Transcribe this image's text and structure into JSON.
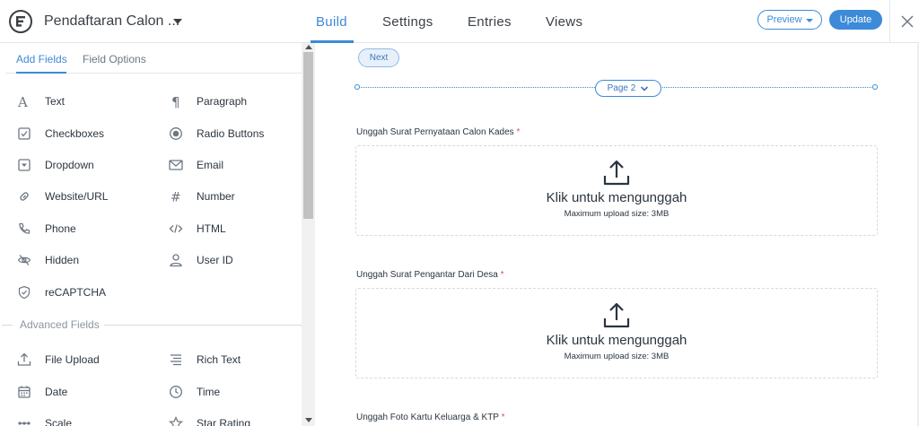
{
  "header": {
    "form_title": "Pendaftaran Calon ...",
    "tabs": [
      {
        "label": "Build",
        "active": true
      },
      {
        "label": "Settings",
        "active": false
      },
      {
        "label": "Entries",
        "active": false
      },
      {
        "label": "Views",
        "active": false
      }
    ],
    "preview_label": "Preview",
    "update_label": "Update"
  },
  "sidebar": {
    "tabs": [
      {
        "label": "Add Fields",
        "active": true
      },
      {
        "label": "Field Options",
        "active": false
      }
    ],
    "basic_fields": [
      {
        "label": "Text",
        "icon": "text-icon"
      },
      {
        "label": "Paragraph",
        "icon": "paragraph-icon"
      },
      {
        "label": "Checkboxes",
        "icon": "checkbox-icon"
      },
      {
        "label": "Radio Buttons",
        "icon": "radio-icon"
      },
      {
        "label": "Dropdown",
        "icon": "dropdown-icon"
      },
      {
        "label": "Email",
        "icon": "email-icon"
      },
      {
        "label": "Website/URL",
        "icon": "link-icon"
      },
      {
        "label": "Number",
        "icon": "hash-icon"
      },
      {
        "label": "Phone",
        "icon": "phone-icon"
      },
      {
        "label": "HTML",
        "icon": "code-icon"
      },
      {
        "label": "Hidden",
        "icon": "eye-slash-icon"
      },
      {
        "label": "User ID",
        "icon": "user-icon"
      },
      {
        "label": "reCAPTCHA",
        "icon": "shield-icon"
      }
    ],
    "advanced_section_label": "Advanced Fields",
    "advanced_fields": [
      {
        "label": "File Upload",
        "icon": "upload-icon"
      },
      {
        "label": "Rich Text",
        "icon": "align-icon"
      },
      {
        "label": "Date",
        "icon": "calendar-icon"
      },
      {
        "label": "Time",
        "icon": "clock-icon"
      },
      {
        "label": "Scale",
        "icon": "scale-icon"
      },
      {
        "label": "Star Rating",
        "icon": "star-icon"
      }
    ]
  },
  "canvas": {
    "next_label": "Next",
    "page_break_label": "Page 2",
    "upload_fields": [
      {
        "label": "Unggah Surat Pernyataan Calon Kades",
        "required_mark": "*",
        "prompt": "Klik untuk mengunggah",
        "limit": "Maximum upload size: 3MB"
      },
      {
        "label": "Unggah Surat Pengantar Dari Desa",
        "required_mark": "*",
        "prompt": "Klik untuk mengunggah",
        "limit": "Maximum upload size: 3MB"
      },
      {
        "label": "Unggah Foto Kartu Keluarga & KTP",
        "required_mark": "*"
      }
    ]
  },
  "colors": {
    "accent": "#3c8ad8",
    "required": "#d9534f",
    "text": "#2b3540"
  }
}
